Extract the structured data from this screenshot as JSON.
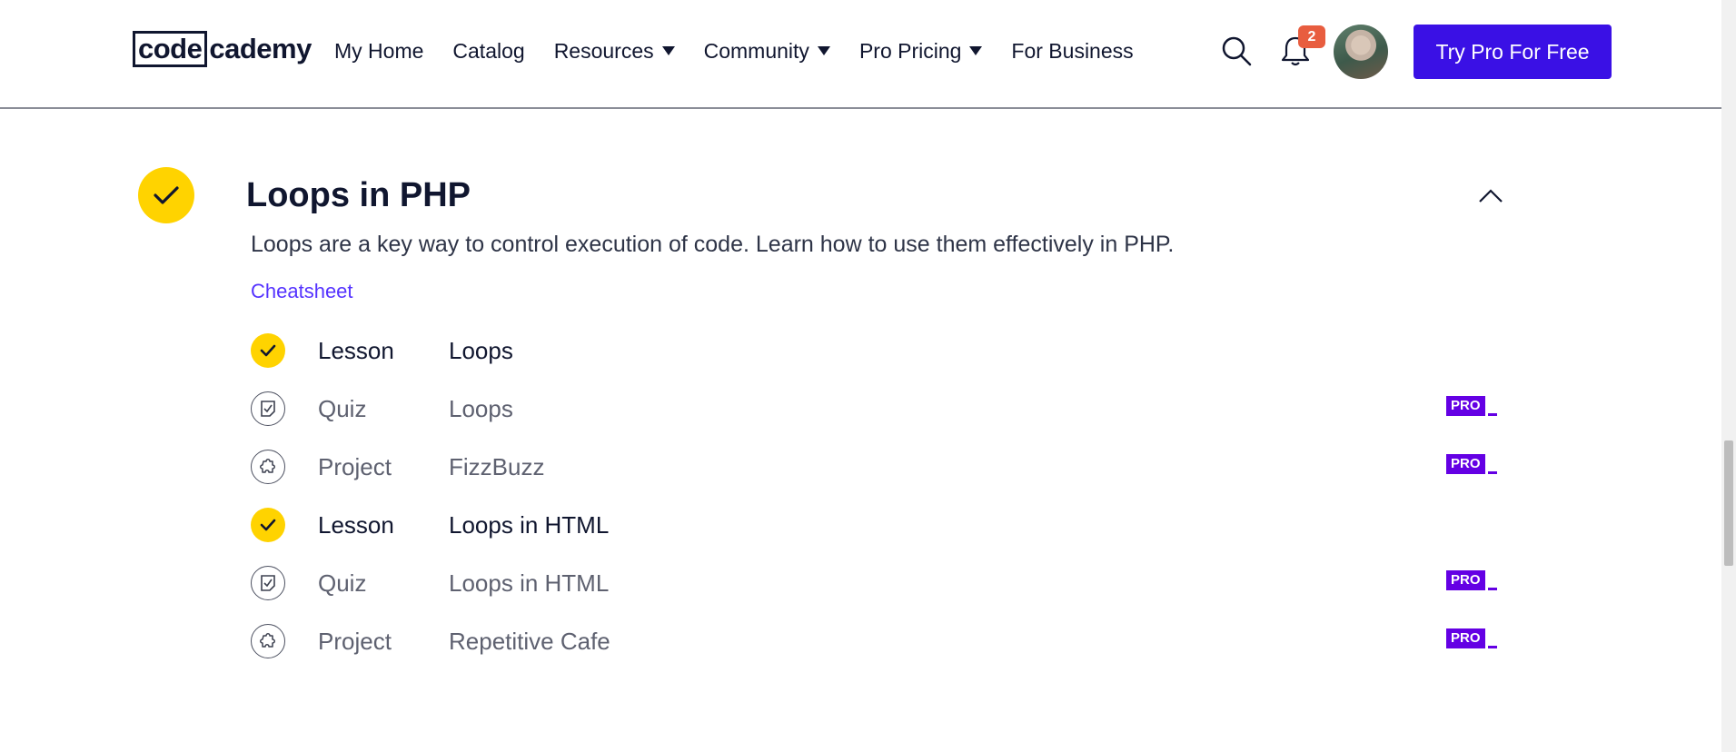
{
  "header": {
    "logo_boxed": "code",
    "logo_rest": "cademy",
    "nav": [
      {
        "label": "My Home",
        "dropdown": false
      },
      {
        "label": "Catalog",
        "dropdown": false
      },
      {
        "label": "Resources",
        "dropdown": true
      },
      {
        "label": "Community",
        "dropdown": true
      },
      {
        "label": "Pro Pricing",
        "dropdown": true
      },
      {
        "label": "For Business",
        "dropdown": false
      }
    ],
    "notification_count": "2",
    "cta_label": "Try Pro For Free"
  },
  "module": {
    "title": "Loops in PHP",
    "description": "Loops are a key way to control execution of code. Learn how to use them effectively in PHP.",
    "cheatsheet_label": "Cheatsheet",
    "completed": true,
    "items": [
      {
        "type": "Lesson",
        "name": "Loops",
        "icon": "check-icon",
        "completed": true,
        "pro": false
      },
      {
        "type": "Quiz",
        "name": "Loops",
        "icon": "quiz-icon",
        "completed": false,
        "pro": true
      },
      {
        "type": "Project",
        "name": "FizzBuzz",
        "icon": "puzzle-icon",
        "completed": false,
        "pro": true
      },
      {
        "type": "Lesson",
        "name": "Loops in HTML",
        "icon": "check-icon",
        "completed": true,
        "pro": false
      },
      {
        "type": "Quiz",
        "name": "Loops in HTML",
        "icon": "quiz-icon",
        "completed": false,
        "pro": true
      },
      {
        "type": "Project",
        "name": "Repetitive Cafe",
        "icon": "puzzle-icon",
        "completed": false,
        "pro": true
      }
    ],
    "pro_badge": "PRO"
  },
  "colors": {
    "brand_blue": "#3a10e5",
    "check_yellow": "#ffd300",
    "pro_purple": "#6400e4",
    "link": "#5533ff",
    "notification_red": "#e85d3f"
  }
}
